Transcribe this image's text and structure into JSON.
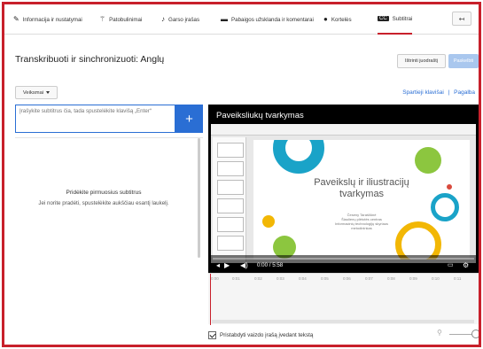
{
  "tabs": [
    {
      "label": "Informacija ir nustatymai",
      "icon": "pencil-icon"
    },
    {
      "label": "Patobulinimai",
      "icon": "magic-wand-icon"
    },
    {
      "label": "Garso įrašas",
      "icon": "music-note-icon"
    },
    {
      "label": "Pabaigos užsklanda ir komentarai",
      "icon": "end-screen-icon"
    },
    {
      "label": "Kortelės",
      "icon": "info-icon"
    },
    {
      "label": "Subtitrai",
      "icon": "cc-icon",
      "active": true
    }
  ],
  "back_icon": "back-arrow-icon",
  "header": {
    "title": "Transkribuoti ir sinchronizuoti: Anglų",
    "discard_label": "Ištrinti juodraštį",
    "publish_label": "Paskelbti"
  },
  "actions": {
    "label": "Veiksmai"
  },
  "links": {
    "shortcuts": "Spartieji klavišai",
    "separator": "|",
    "help": "Pagalba"
  },
  "caption_input": {
    "placeholder": "Įrašykite subtitrus čia, tada spustelėkite klavišą „Enter“"
  },
  "add_button_label": "+",
  "empty_state": {
    "title": "Pridėkite pirmuosius subtitrus",
    "subtitle": "Jei norite pradėti, spustelėkite aukščiau esantį laukelį."
  },
  "video": {
    "title": "Paveiksliukų tvarkymas",
    "slide_title_line1": "Paveikslų ir iliustracijų",
    "slide_title_line2": "tvarkymas",
    "slide_sub_line1": "Česeny Tarašliūnė",
    "slide_sub_line2": "Šiaulienų plėtotės centras",
    "slide_sub_line3": "Informacinių technologijų skyriaus",
    "slide_sub_line4": "metodininkas",
    "time": "0:00 / 5:58"
  },
  "timeline_ticks": [
    "0:00",
    "0:01",
    "0:02",
    "0:03",
    "0:04",
    "0:05",
    "0:06",
    "0:07",
    "0:08",
    "0:09",
    "0:10",
    "0:11"
  ],
  "footer": {
    "pause_label": "Pristabdyti vaizdo įrašą įvedant tekstą",
    "pause_checked": true
  },
  "colors": {
    "accent_red": "#c8202b",
    "link_blue": "#2a6ed4",
    "publish_disabled": "#a9c7ee"
  }
}
